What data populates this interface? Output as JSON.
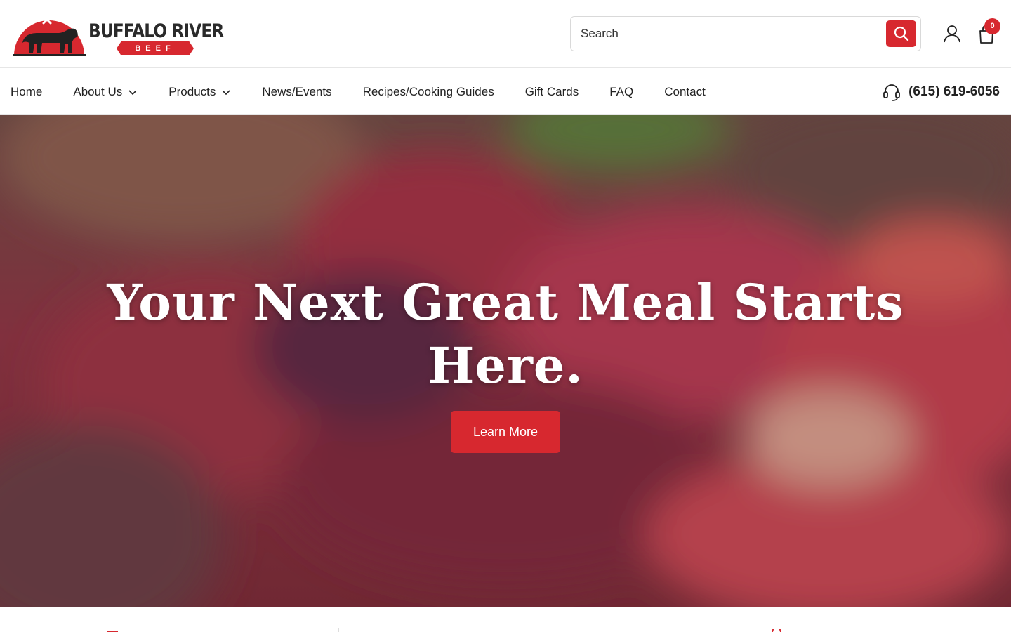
{
  "brand": {
    "name": "BUFFALO RIVER",
    "subname": "BEEF",
    "red": "#d7282f"
  },
  "header": {
    "search_placeholder": "Search",
    "search_icon": "search-icon",
    "account_icon": "user-icon",
    "cart_icon": "shopping-bag-icon",
    "cart_count": "0"
  },
  "nav": {
    "items": [
      {
        "label": "Home"
      },
      {
        "label": "About Us",
        "dropdown": true
      },
      {
        "label": "Products",
        "dropdown": true
      },
      {
        "label": "News/Events"
      },
      {
        "label": "Recipes/Cooking Guides"
      },
      {
        "label": "Gift Cards"
      },
      {
        "label": "FAQ"
      },
      {
        "label": "Contact"
      }
    ],
    "phone_icon": "headset-icon",
    "phone": "(615) 619-6056"
  },
  "hero": {
    "title": "Your Next Great Meal Starts Here.",
    "button_label": "Learn More"
  }
}
